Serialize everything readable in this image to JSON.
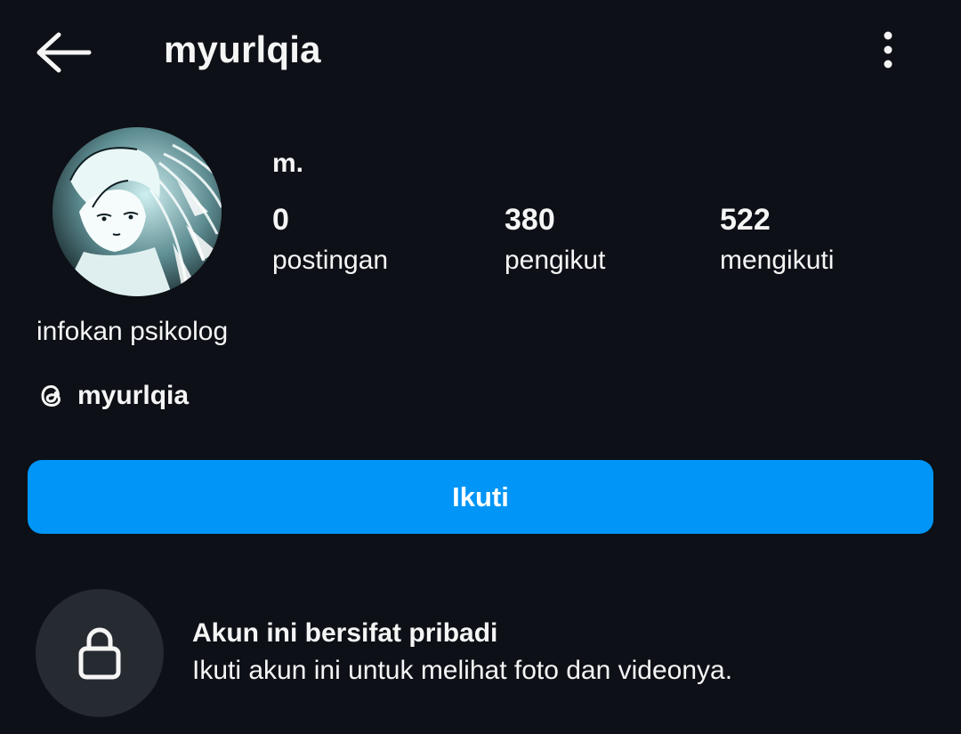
{
  "header": {
    "title": "myurlqia",
    "back_icon": "arrow-left-icon",
    "more_icon": "more-vertical-icon"
  },
  "profile": {
    "display_name": "m.",
    "avatar_icon": "anime-illustration-avatar",
    "stats": {
      "posts": {
        "value": "0",
        "label": "postingan"
      },
      "followers": {
        "value": "380",
        "label": "pengikut"
      },
      "following": {
        "value": "522",
        "label": "mengikuti"
      }
    },
    "bio": "infokan psikolog",
    "threads": {
      "icon": "threads-icon",
      "handle": "myurlqia"
    }
  },
  "actions": {
    "follow_label": "Ikuti",
    "follow_color": "#0095f6"
  },
  "private_notice": {
    "icon": "lock-icon",
    "title": "Akun ini bersifat pribadi",
    "description": "Ikuti akun ini untuk melihat foto dan videonya."
  },
  "colors": {
    "background": "#0d1016",
    "text": "#f5f5f5",
    "lock_circle": "#262a31"
  }
}
